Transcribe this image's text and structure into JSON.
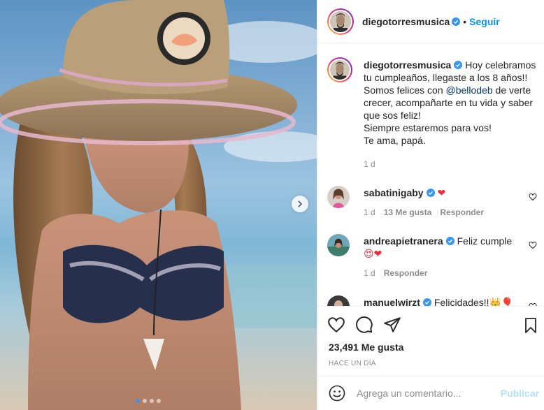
{
  "post": {
    "username": "diegotorresmusica",
    "follow_label": "Seguir",
    "separator": "•",
    "caption_lines": [
      "Hoy celebramos",
      "tu cumpleaños, llegaste a los 8 años!!",
      "Somos felices con",
      "@bellodeb",
      "de verte",
      "crecer, acompañarte en tu vida y saber",
      "que sos feliz!",
      "Siempre estaremos para vos!",
      "Te ama, papá."
    ],
    "caption_time": "1 d"
  },
  "comments": [
    {
      "username": "sabatinigaby",
      "text": "",
      "emoji": "❤",
      "time": "1 d",
      "likes": "13 Me gusta",
      "reply": "Responder"
    },
    {
      "username": "andreapietranera",
      "text": "Feliz cumple",
      "emoji": "😍❤",
      "time": "1 d",
      "reply": "Responder"
    },
    {
      "username": "manuelwirzt",
      "text": "Felicidades!!",
      "emoji": "👑🎈"
    }
  ],
  "actions": {
    "likes": "23,491 Me gusta",
    "ago": "HACE UN DÍA"
  },
  "composer": {
    "placeholder": "Agrega un comentario...",
    "publish": "Publicar"
  },
  "carousel": {
    "total": 4,
    "current": 1
  },
  "icons": [
    "verified-icon",
    "heart-icon",
    "comment-icon",
    "share-icon",
    "bookmark-icon",
    "emoji-icon",
    "chevron-right-icon"
  ],
  "colors": {
    "accent": "#0095f6",
    "verified": "#3897f0",
    "heart_red": "#ed4956",
    "muted": "#8e8e8e"
  }
}
